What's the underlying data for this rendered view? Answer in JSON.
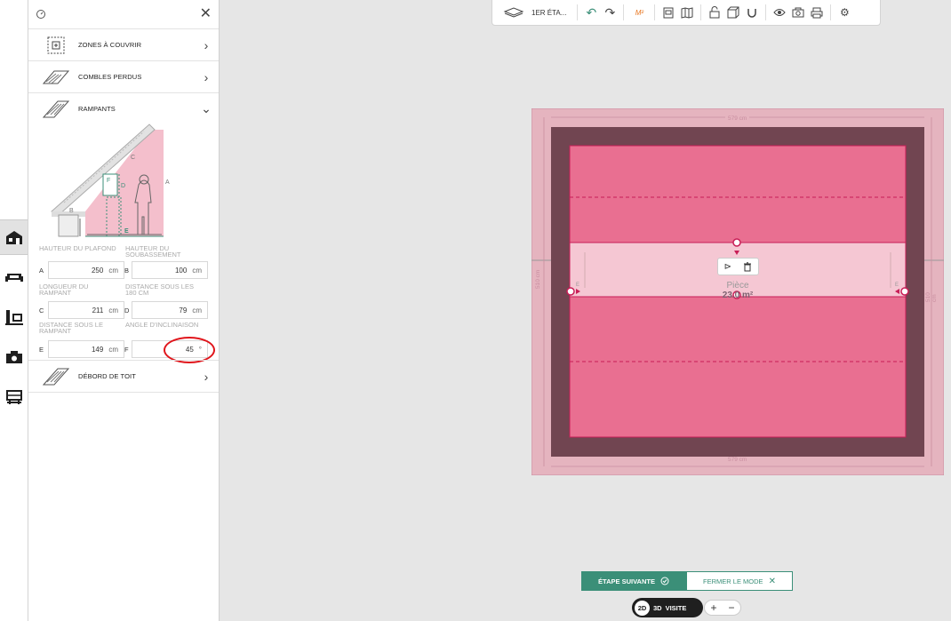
{
  "panel": {
    "sections": {
      "zones": "ZONES À COUVRIR",
      "combles": "COMBLES PERDUS",
      "rampants": "RAMPANTS",
      "debord": "DÉBORD DE TOIT"
    },
    "diagram_letters": {
      "c": "C",
      "f": "F",
      "b": "B",
      "a": "A",
      "d": "D",
      "e": "E"
    },
    "fields": {
      "hauteur_plafond_label": "HAUTEUR DU PLAFOND",
      "hauteur_soubassement_label": "HAUTEUR DU SOUBASSEMENT",
      "longueur_rampant_label": "LONGUEUR DU RAMPANT",
      "distance_180_label": "DISTANCE SOUS LES 180 CM",
      "distance_rampant_label": "DISTANCE SOUS LE RAMPANT",
      "angle_label": "ANGLE D'INCLINAISON",
      "a_letter": "A",
      "a_value": "250",
      "a_unit": "cm",
      "b_letter": "B",
      "b_value": "100",
      "b_unit": "cm",
      "c_letter": "C",
      "c_value": "211",
      "c_unit": "cm",
      "d_letter": "D",
      "d_value": "79",
      "d_unit": "cm",
      "e_letter": "E",
      "e_value": "149",
      "e_unit": "cm",
      "f_letter": "F",
      "f_value": "45",
      "f_unit": "°"
    }
  },
  "toolbar": {
    "floor": "1ER ÉTA...",
    "m2": "M²"
  },
  "plan": {
    "width_top": "579 cm",
    "width_bottom": "579 cm",
    "height_left": "510 cm",
    "height_right": "510 cm",
    "room_name": "Pièce",
    "room_area": "23.0 m²",
    "marker": "E"
  },
  "footer": {
    "next_label": "ÉTAPE SUIVANTE",
    "close_mode_label": "FERMER LE MODE",
    "view_2d": "2D",
    "view_3d": "3D",
    "view_visit": "VISITE",
    "zoom_in": "+",
    "zoom_out": "−"
  },
  "colors": {
    "accent": "#3b8f78",
    "pink_zone": "#e96f91",
    "dark_wall": "#714551",
    "outer_zone": "#e5b4bf",
    "highlight": "#c81e57"
  }
}
